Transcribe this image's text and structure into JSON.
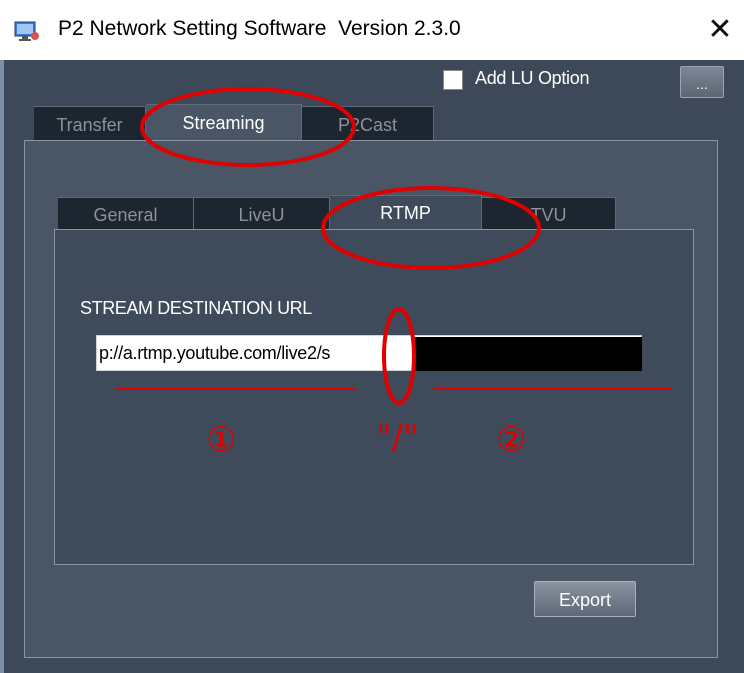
{
  "window": {
    "title": "P2 Network Setting Software  Version 2.3.0",
    "close_glyph": "✕"
  },
  "options": {
    "add_lu_label": "Add LU Option",
    "add_lu_checked": false,
    "more_button_label": "..."
  },
  "top_tabs": [
    {
      "label": "Transfer",
      "active": false
    },
    {
      "label": "Streaming",
      "active": true
    },
    {
      "label": "P2Cast",
      "active": false
    }
  ],
  "sub_tabs": [
    {
      "label": "General",
      "active": false
    },
    {
      "label": "LiveU",
      "active": false
    },
    {
      "label": "RTMP",
      "active": true
    },
    {
      "label": "TVU",
      "active": false
    }
  ],
  "rtmp": {
    "url_label": "STREAM DESTINATION URL",
    "url_value": "p://a.rtmp.youtube.com/live2/s"
  },
  "export_label": "Export",
  "annotations": {
    "part1": "①",
    "slash": "\"/\"",
    "part2": "②",
    "color": "#e00000"
  }
}
